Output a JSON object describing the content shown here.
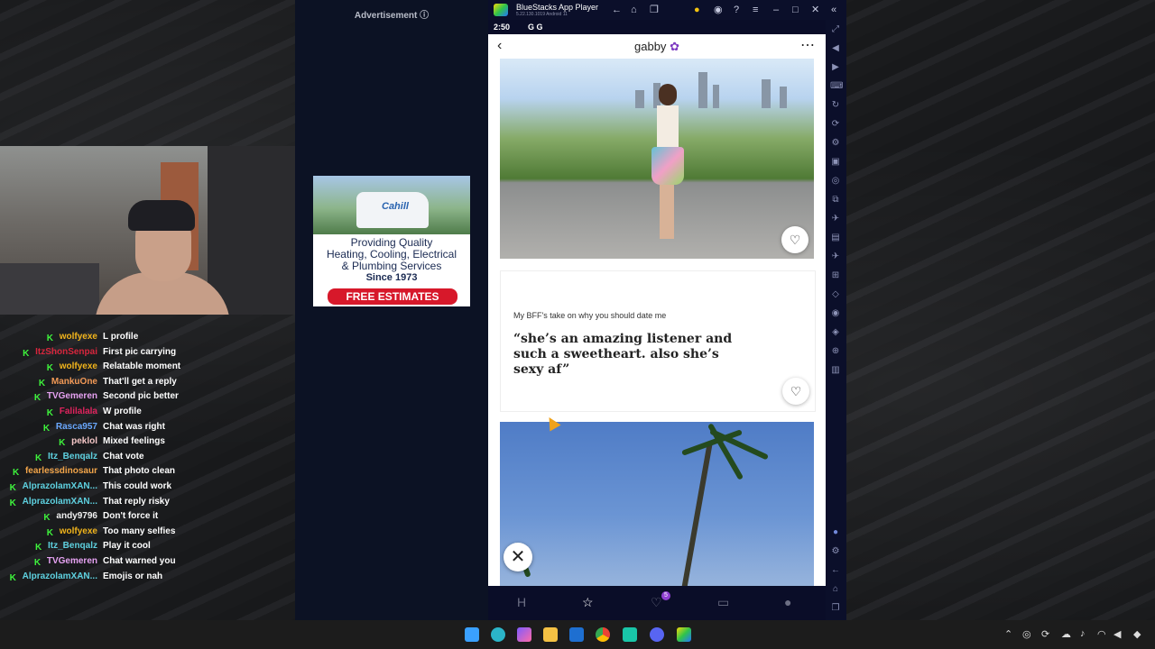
{
  "ad": {
    "header": "Advertisement",
    "info_icon": "info-icon",
    "brand": "Cahill",
    "line1": "Providing Quality",
    "line2": "Heating, Cooling, Electrical",
    "line3": "& Plumbing Services",
    "since": "Since 1973",
    "cta": "FREE ESTIMATES"
  },
  "chat": [
    {
      "user": "wolfyexe",
      "color": "#f2b51c",
      "msg": "L profile"
    },
    {
      "user": "ItzShonSenpai",
      "color": "#d7263d",
      "msg": "First pic carrying"
    },
    {
      "user": "wolfyexe",
      "color": "#f2b51c",
      "msg": "Relatable moment"
    },
    {
      "user": "MankuOne",
      "color": "#f39a57",
      "msg": "That'll get a reply"
    },
    {
      "user": "TVGemeren",
      "color": "#e6a2f2",
      "msg": "Second pic better"
    },
    {
      "user": "Falilalala",
      "color": "#e0245e",
      "msg": "W profile"
    },
    {
      "user": "Rasca957",
      "color": "#6aa8ff",
      "msg": "Chat was right"
    },
    {
      "user": "peklol",
      "color": "#f3c6c6",
      "msg": "Mixed feelings"
    },
    {
      "user": "Itz_Benqalz",
      "color": "#5ed1e0",
      "msg": "Chat vote"
    },
    {
      "user": "fearlessdinosaur",
      "color": "#f2a54a",
      "msg": "That photo clean"
    },
    {
      "user": "AlprazolamXAN...",
      "color": "#5ed1e0",
      "msg": "This could work"
    },
    {
      "user": "AlprazolamXAN...",
      "color": "#5ed1e0",
      "msg": "That reply risky"
    },
    {
      "user": "andy9796",
      "color": "#f0f0f0",
      "msg": "Don't force it"
    },
    {
      "user": "wolfyexe",
      "color": "#f2b51c",
      "msg": "Too many selfies"
    },
    {
      "user": "Itz_Benqalz",
      "color": "#5ed1e0",
      "msg": "Play it cool"
    },
    {
      "user": "TVGemeren",
      "color": "#e6a2f2",
      "msg": "Chat warned you"
    },
    {
      "user": "AlprazolamXAN...",
      "color": "#5ed1e0",
      "msg": "Emojis or nah"
    }
  ],
  "bluestacks": {
    "title": "BlueStacks App Player",
    "version": "5.22.130.1019 Android 11"
  },
  "phone": {
    "time": "2:50",
    "status_icons": "G  G",
    "profile_name": "gabby",
    "prompt_question": "My BFF's take on why you should date me",
    "prompt_answer": "“she’s an amazing listener and such a sweetheart. also she’s sexy af”",
    "likes_badge": "5"
  }
}
